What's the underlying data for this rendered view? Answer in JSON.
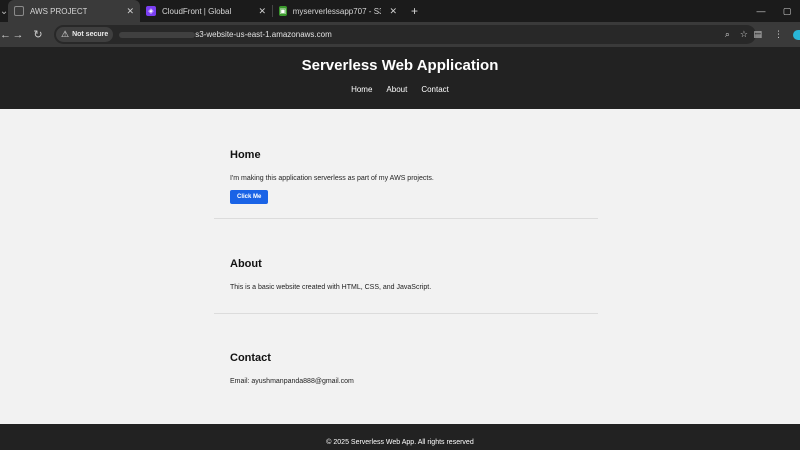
{
  "browser": {
    "tabs": [
      {
        "title": "AWS PROJECT",
        "close": "✕"
      },
      {
        "title": "CloudFront | Global",
        "close": "✕"
      },
      {
        "title": "myserverlessapp707 - S3 bucke",
        "close": "✕"
      }
    ],
    "new_tab": "+",
    "not_secure_label": "Not secure",
    "url_visible": "s3-website-us-east-1.amazonaws.com"
  },
  "site": {
    "title": "Serverless Web Application",
    "nav": [
      "Home",
      "About",
      "Contact"
    ],
    "home": {
      "heading": "Home",
      "text": "I'm making this application serverless as part of my AWS projects.",
      "button": "Click Me"
    },
    "about": {
      "heading": "About",
      "text": "This is a basic website created with HTML, CSS, and JavaScript."
    },
    "contact": {
      "heading": "Contact",
      "text": "Email: ayushmanpanda888@gmail.com"
    },
    "footer": "© 2025 Serverless Web App. All rights reserved"
  },
  "colors": {
    "header_bg": "#222222",
    "page_bg": "#f2f2f2",
    "button_bg": "#1a63e6"
  }
}
